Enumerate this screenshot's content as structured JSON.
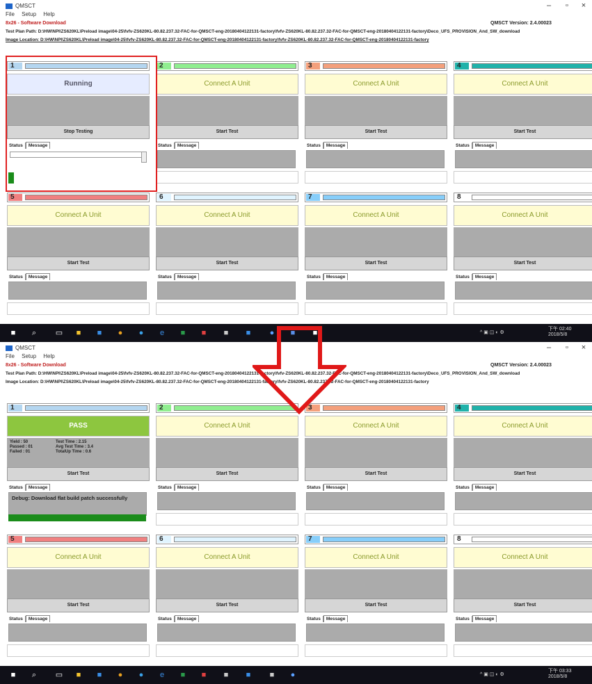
{
  "window": {
    "title": "QMSCT",
    "minimize": "–",
    "maximize": "▫",
    "close": "×"
  },
  "menu": [
    "File",
    "Setup",
    "Help"
  ],
  "subtitle": "8x26 - Software Download",
  "version": "QMSCT Version: 2.4.00023",
  "test_plan_path": "Test Plan Path: D:\\HW\\NPI\\ZS620KL\\Preload image\\04-25\\fvfv-ZS620KL-80.82.237.32-FAC-for-QMSCT-eng-20180404122131-factory\\fvfv-ZS620KL-80.82.237.32-FAC-for-QMSCT-eng-20180404122131-factory\\Deco_UFS_PROVISION_And_SW_download",
  "image_location": "Image Location: D:\\HW\\NPI\\ZS620KL\\Preload image\\04-25\\fvfv-ZS620KL-80.82.237.32-FAC-for-QMSCT-eng-20180404122131-factory\\fvfv-ZS620KL-80.82.237.32-FAC-for-QMSCT-eng-20180404122131-factory",
  "slots": [
    {
      "num": "1",
      "color": "#b4d6f0"
    },
    {
      "num": "2",
      "color": "#90ee90"
    },
    {
      "num": "3",
      "color": "#f4a07c"
    },
    {
      "num": "4",
      "color": "#20b2aa"
    },
    {
      "num": "5",
      "color": "#f08080"
    },
    {
      "num": "6",
      "color": "#e0f4ff"
    },
    {
      "num": "7",
      "color": "#87cefa"
    },
    {
      "num": "8",
      "color": "#ffffff"
    }
  ],
  "connect_label": "Connect A Unit",
  "start_label": "Start Test",
  "stop_label": "Stop Testing",
  "running_label": "Running",
  "pass_label": "PASS",
  "tab_status": "Status",
  "tab_message": "Message",
  "stats": {
    "yield": "Yield : 50",
    "passed": "Passed : 01",
    "failed": "Failed : 01",
    "test_time": "Test Time : 2.15",
    "avg_time": "Avg Test Time : 3.4",
    "total_time": "TotalUp Time : 0.6"
  },
  "debug_msg": "Debug: Download flat build patch successfully",
  "clockA": "下午 02:40\n2018/5/8",
  "clockB": "下午 03:33\n2018/5/8"
}
